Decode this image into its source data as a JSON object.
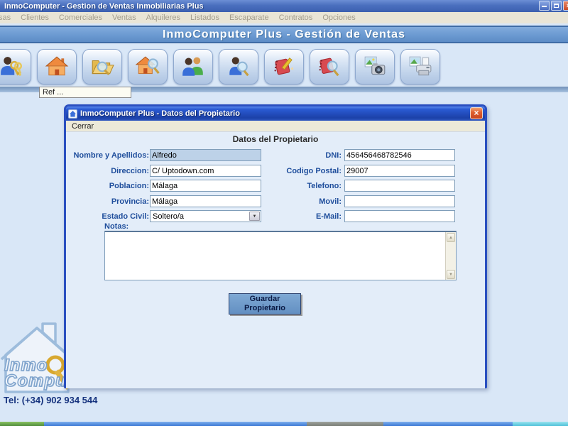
{
  "window": {
    "title": "InmoComputer - Gestion de Ventas Inmobiliarias Plus",
    "buttons": {
      "minimize": "minimize",
      "restore": "restore",
      "close": "close"
    }
  },
  "menubar": {
    "items": [
      "sas",
      "Clientes",
      "Comerciales",
      "Ventas",
      "Alquileres",
      "Listados",
      "Escaparate",
      "Contratos",
      "Opciones"
    ]
  },
  "header": {
    "title": "InmoComputer Plus - Gestión de Ventas"
  },
  "toolbar": {
    "buttons": [
      "owner-keys-icon",
      "house-icon",
      "folder-search-icon",
      "house-search-icon",
      "clients-icon",
      "person-search-icon",
      "notebook-edit-icon",
      "notebook-search-icon",
      "photo-camera-icon",
      "photo-printer-icon"
    ],
    "ref_tooltip": "Ref ..."
  },
  "dialog": {
    "title": "InmoComputer Plus - Datos del Propietario",
    "close_glyph": "×",
    "menu": {
      "cerrar": "Cerrar"
    },
    "form": {
      "heading": "Datos del Propietario",
      "fields": {
        "nombre": {
          "label": "Nombre y Apellidos:",
          "value": "Alfredo"
        },
        "direccion": {
          "label": "Direccion:",
          "value": "C/ Uptodown.com"
        },
        "poblacion": {
          "label": "Poblacion:",
          "value": "Málaga"
        },
        "provincia": {
          "label": "Provincia:",
          "value": "Málaga"
        },
        "estado_civil": {
          "label": "Estado Civil:",
          "value": "Soltero/a"
        },
        "dni": {
          "label": "DNI:",
          "value": "456456468782546"
        },
        "codigo_postal": {
          "label": "Codigo Postal:",
          "value": "29007"
        },
        "telefono": {
          "label": "Telefono:",
          "value": ""
        },
        "movil": {
          "label": "Movil:",
          "value": ""
        },
        "email": {
          "label": "E-Mail:",
          "value": ""
        },
        "notas": {
          "label": "Notas:",
          "value": ""
        }
      },
      "save_button_line1": "Guardar",
      "save_button_line2": "Propietario"
    }
  },
  "footer": {
    "logo_line1": "Inmo",
    "logo_line2": "Comput",
    "tel": "Tel: (+34) 902 934 544"
  },
  "colors": {
    "titlebar_blue": "#4a6fbe",
    "header_blue": "#6b9ad1",
    "dialog_border": "#2a4fc0",
    "label_blue": "#1f4e9c",
    "save_button_blue": "#6e9ecf",
    "close_red": "#d6502a",
    "background": "#d9e7f7"
  }
}
